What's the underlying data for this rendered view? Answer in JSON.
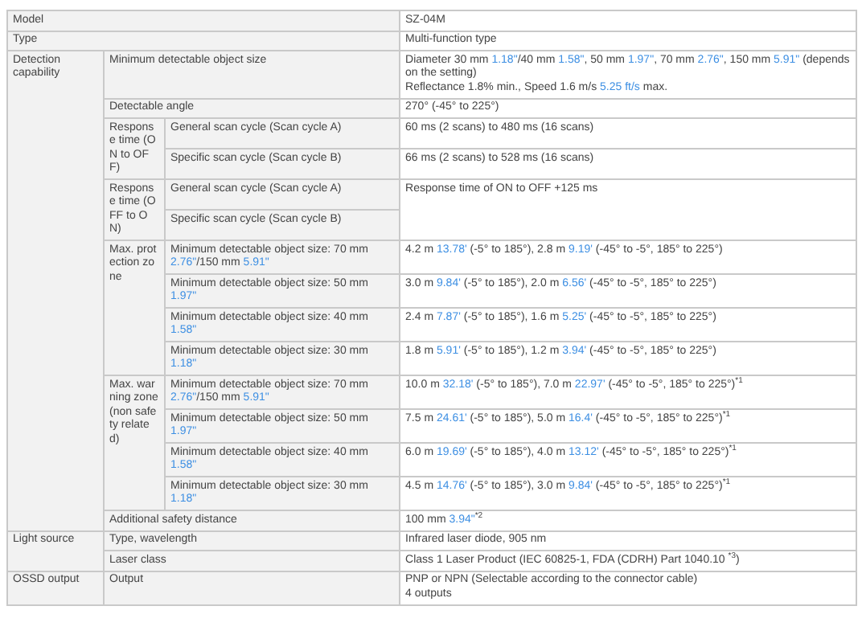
{
  "sections": [
    {
      "label": "Model",
      "value": "SZ-04M"
    },
    {
      "label": "Type",
      "value": "Multi-function type"
    },
    {
      "label": "Detection capability",
      "items": [
        {
          "label": "Minimum detectable object size",
          "value": [
            [
              {
                "text": "Diameter 30 mm ",
                "kind": "text"
              },
              {
                "text": "1.18\"",
                "kind": "imperial"
              },
              {
                "text": "/40 mm ",
                "kind": "text"
              },
              {
                "text": "1.58\"",
                "kind": "imperial"
              },
              {
                "text": ", 50 mm ",
                "kind": "text"
              },
              {
                "text": "1.97\"",
                "kind": "imperial"
              },
              {
                "text": ", 70 mm ",
                "kind": "text"
              },
              {
                "text": "2.76\"",
                "kind": "imperial"
              },
              {
                "text": ", 150 mm ",
                "kind": "text"
              },
              {
                "text": "5.91\"",
                "kind": "imperial"
              },
              {
                "text": " (depends on the setting)",
                "kind": "text"
              }
            ],
            [
              {
                "text": "Reflectance 1.8% min., Speed 1.6 m/s ",
                "kind": "text"
              },
              {
                "text": "5.25 ft/s",
                "kind": "imperial"
              },
              {
                "text": " max.",
                "kind": "text"
              }
            ]
          ]
        },
        {
          "label": "Detectable angle",
          "value": "270° (-45° to 225°)"
        },
        {
          "label": "Response time (ON to OFF)",
          "subs": [
            {
              "label": "General scan cycle (Scan cycle A)",
              "value": "60 ms (2 scans) to 480 ms (16 scans)"
            },
            {
              "label": "Specific scan cycle (Scan cycle B)",
              "value": "66 ms (2 scans) to 528 ms (16 scans)"
            }
          ]
        },
        {
          "label": "Response time (OFF to ON)",
          "value": "Response time of ON to OFF +125 ms",
          "subs": [
            {
              "label": "General scan cycle (Scan cycle A)"
            },
            {
              "label": "Specific scan cycle (Scan cycle B)"
            }
          ]
        },
        {
          "label": "Max. protection zone",
          "subs": [
            {
              "label": [
                [
                  {
                    "text": "Minimum detectable object size: 70 mm ",
                    "kind": "text"
                  },
                  {
                    "text": "2.76\"",
                    "kind": "imperial"
                  },
                  {
                    "text": "/150 mm ",
                    "kind": "text"
                  },
                  {
                    "text": "5.91\"",
                    "kind": "imperial"
                  }
                ]
              ],
              "value": [
                [
                  {
                    "text": "4.2 m ",
                    "kind": "text"
                  },
                  {
                    "text": "13.78'",
                    "kind": "imperial"
                  },
                  {
                    "text": " (-5° to 185°), 2.8 m ",
                    "kind": "text"
                  },
                  {
                    "text": "9.19'",
                    "kind": "imperial"
                  },
                  {
                    "text": " (-45° to -5°, 185° to 225°)",
                    "kind": "text"
                  }
                ]
              ]
            },
            {
              "label": [
                [
                  {
                    "text": "Minimum detectable object size: 50 mm ",
                    "kind": "text"
                  },
                  {
                    "text": "1.97\"",
                    "kind": "imperial"
                  }
                ]
              ],
              "value": [
                [
                  {
                    "text": "3.0 m ",
                    "kind": "text"
                  },
                  {
                    "text": "9.84'",
                    "kind": "imperial"
                  },
                  {
                    "text": " (-5° to 185°), 2.0 m ",
                    "kind": "text"
                  },
                  {
                    "text": "6.56'",
                    "kind": "imperial"
                  },
                  {
                    "text": " (-45° to -5°, 185° to 225°)",
                    "kind": "text"
                  }
                ]
              ]
            },
            {
              "label": [
                [
                  {
                    "text": "Minimum detectable object size: 40 mm ",
                    "kind": "text"
                  },
                  {
                    "text": "1.58\"",
                    "kind": "imperial"
                  }
                ]
              ],
              "value": [
                [
                  {
                    "text": "2.4 m ",
                    "kind": "text"
                  },
                  {
                    "text": "7.87'",
                    "kind": "imperial"
                  },
                  {
                    "text": " (-5° to 185°), 1.6 m ",
                    "kind": "text"
                  },
                  {
                    "text": "5.25'",
                    "kind": "imperial"
                  },
                  {
                    "text": " (-45° to -5°, 185° to 225°)",
                    "kind": "text"
                  }
                ]
              ]
            },
            {
              "label": [
                [
                  {
                    "text": "Minimum detectable object size: 30 mm ",
                    "kind": "text"
                  },
                  {
                    "text": "1.18\"",
                    "kind": "imperial"
                  }
                ]
              ],
              "value": [
                [
                  {
                    "text": "1.8 m ",
                    "kind": "text"
                  },
                  {
                    "text": "5.91'",
                    "kind": "imperial"
                  },
                  {
                    "text": " (-5° to 185°), 1.2 m ",
                    "kind": "text"
                  },
                  {
                    "text": "3.94'",
                    "kind": "imperial"
                  },
                  {
                    "text": " (-45° to -5°, 185° to 225°)",
                    "kind": "text"
                  }
                ]
              ]
            }
          ]
        },
        {
          "label": "Max. warning zone (non safety related)",
          "subs": [
            {
              "label": [
                [
                  {
                    "text": "Minimum detectable object size: 70 mm ",
                    "kind": "text"
                  },
                  {
                    "text": "2.76\"",
                    "kind": "imperial"
                  },
                  {
                    "text": "/150 mm ",
                    "kind": "text"
                  },
                  {
                    "text": "5.91\"",
                    "kind": "imperial"
                  }
                ]
              ],
              "value": [
                [
                  {
                    "text": "10.0 m ",
                    "kind": "text"
                  },
                  {
                    "text": "32.18'",
                    "kind": "imperial"
                  },
                  {
                    "text": " (-5° to 185°), 7.0 m ",
                    "kind": "text"
                  },
                  {
                    "text": "22.97'",
                    "kind": "imperial"
                  },
                  {
                    "text": " (-45° to -5°, 185° to 225°)$^{*1}$",
                    "kind": "text"
                  }
                ]
              ]
            },
            {
              "label": [
                [
                  {
                    "text": "Minimum detectable object size: 50 mm ",
                    "kind": "text"
                  },
                  {
                    "text": "1.97\"",
                    "kind": "imperial"
                  }
                ]
              ],
              "value": [
                [
                  {
                    "text": "7.5 m ",
                    "kind": "text"
                  },
                  {
                    "text": "24.61'",
                    "kind": "imperial"
                  },
                  {
                    "text": " (-5° to 185°), 5.0 m ",
                    "kind": "text"
                  },
                  {
                    "text": "16.4'",
                    "kind": "imperial"
                  },
                  {
                    "text": " (-45° to -5°, 185° to 225°)$^{*1}$",
                    "kind": "text"
                  }
                ]
              ]
            },
            {
              "label": [
                [
                  {
                    "text": "Minimum detectable object size: 40 mm ",
                    "kind": "text"
                  },
                  {
                    "text": "1.58\"",
                    "kind": "imperial"
                  }
                ]
              ],
              "value": [
                [
                  {
                    "text": "6.0 m ",
                    "kind": "text"
                  },
                  {
                    "text": "19.69'",
                    "kind": "imperial"
                  },
                  {
                    "text": " (-5° to 185°), 4.0 m ",
                    "kind": "text"
                  },
                  {
                    "text": "13.12'",
                    "kind": "imperial"
                  },
                  {
                    "text": " (-45° to -5°, 185° to 225°)$^{*1}$",
                    "kind": "text"
                  }
                ]
              ]
            },
            {
              "label": [
                [
                  {
                    "text": "Minimum detectable object size: 30 mm ",
                    "kind": "text"
                  },
                  {
                    "text": "1.18\"",
                    "kind": "imperial"
                  }
                ]
              ],
              "value": [
                [
                  {
                    "text": "4.5 m ",
                    "kind": "text"
                  },
                  {
                    "text": "14.76'",
                    "kind": "imperial"
                  },
                  {
                    "text": " (-5° to 185°), 3.0 m ",
                    "kind": "text"
                  },
                  {
                    "text": "9.84'",
                    "kind": "imperial"
                  },
                  {
                    "text": " (-45° to -5°, 185° to 225°)$^{*1}$",
                    "kind": "text"
                  }
                ]
              ]
            }
          ]
        },
        {
          "label": "Additional safety distance",
          "value": [
            [
              {
                "text": "100 mm ",
                "kind": "text"
              },
              {
                "text": "3.94\"",
                "kind": "imperial"
              },
              {
                "text": "$^{*2}$",
                "kind": "text"
              }
            ]
          ]
        }
      ]
    },
    {
      "label": "Light source",
      "items": [
        {
          "label": "Type, wavelength",
          "value": "Infrared laser diode, 905 nm"
        },
        {
          "label": "Laser class",
          "value": [
            [
              {
                "text": "Class 1 Laser Product (IEC 60825-1, FDA (CDRH) Part 1040.10 $^{*3}$)",
                "kind": "text"
              }
            ]
          ]
        }
      ]
    },
    {
      "label": "OSSD output",
      "items": [
        {
          "label": "Output",
          "value": [
            [
              {
                "text": "PNP or NPN (Selectable according to the connector cable)",
                "kind": "text"
              }
            ],
            [
              {
                "text": "4 outputs",
                "kind": "text"
              }
            ]
          ]
        }
      ]
    }
  ]
}
